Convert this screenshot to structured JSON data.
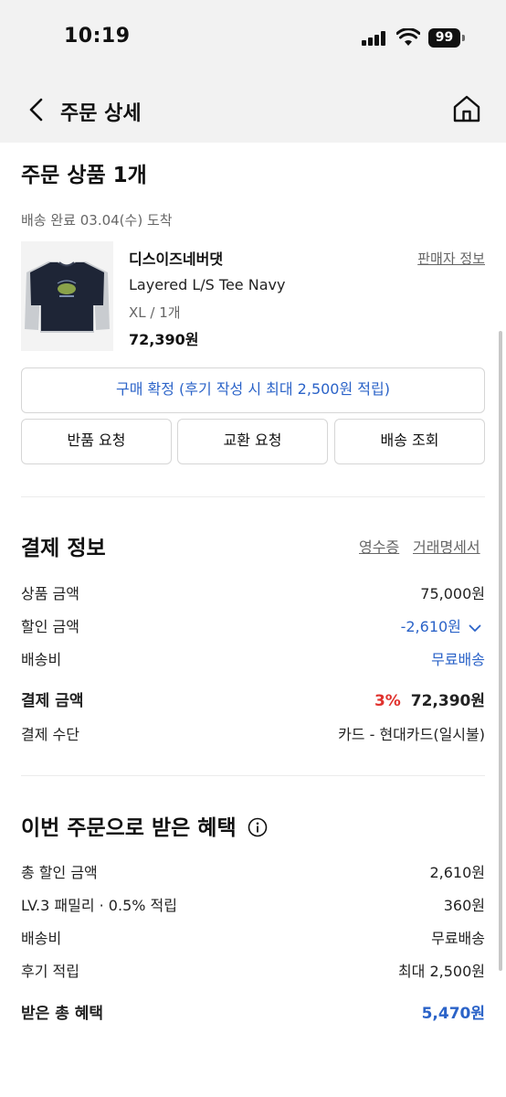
{
  "status_bar": {
    "time": "10:19",
    "battery": "99"
  },
  "nav": {
    "title": "주문 상세"
  },
  "order": {
    "heading": "주문 상품 1개",
    "delivery_status": "배송 완료 03.04(수) 도착",
    "seller_link": "판매자 정보",
    "product": {
      "brand": "디스이즈네버댓",
      "name": "Layered L/S Tee Navy",
      "option": "XL / 1개",
      "price": "72,390원"
    },
    "confirm_button": "구매 확정 (후기 작성 시 최대 2,500원 적립)",
    "actions": [
      "반품 요청",
      "교환 요청",
      "배송 조회"
    ]
  },
  "payment": {
    "heading": "결제 정보",
    "receipt_link": "영수증",
    "statement_link": "거래명세서",
    "rows": {
      "product_amount": {
        "label": "상품 금액",
        "value": "75,000원"
      },
      "discount": {
        "label": "할인 금액",
        "value": "-2,610원"
      },
      "shipping": {
        "label": "배송비",
        "value": "무료배송"
      },
      "total": {
        "label": "결제 금액",
        "rate": "3%",
        "value": "72,390원"
      },
      "method": {
        "label": "결제 수단",
        "value": "카드 - 현대카드(일시불)"
      }
    }
  },
  "benefits": {
    "heading": "이번 주문으로 받은 혜택",
    "rows": [
      {
        "label": "총 할인 금액",
        "value": "2,610원"
      },
      {
        "label": "LV.3 패밀리 · 0.5% 적립",
        "value": "360원"
      },
      {
        "label": "배송비",
        "value": "무료배송"
      },
      {
        "label": "후기 적립",
        "value": "최대 2,500원"
      }
    ],
    "total": {
      "label": "받은 총 혜택",
      "value": "5,470원"
    }
  },
  "colors": {
    "accent_blue": "#2b63c8",
    "accent_red": "#e0322e",
    "header_bg": "#f2f2f2"
  }
}
